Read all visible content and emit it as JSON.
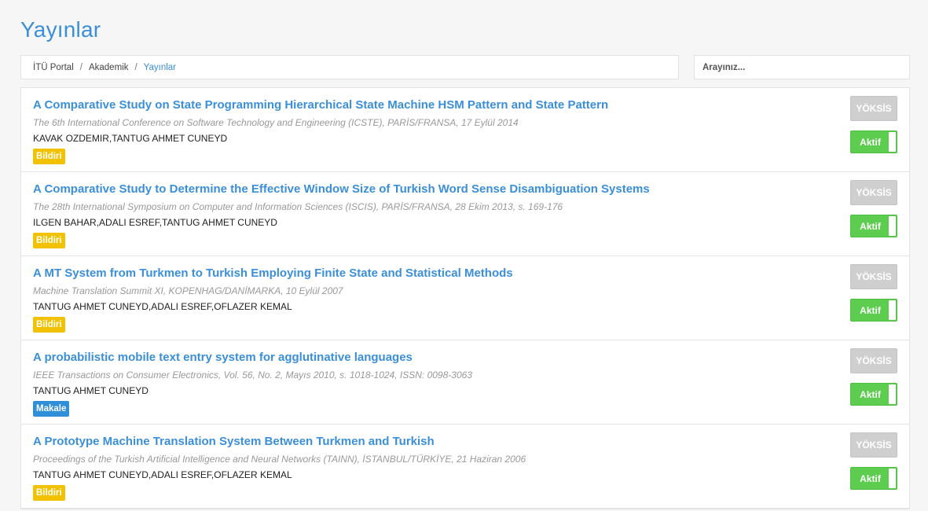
{
  "page": {
    "title": "Yayınlar"
  },
  "breadcrumb": {
    "items": [
      "İTÜ Portal",
      "Akademik",
      "Yayınlar"
    ]
  },
  "search": {
    "placeholder": "Arayınız..."
  },
  "labels": {
    "yoksis": "YÖKSİS",
    "toggle": "Aktif"
  },
  "colors": {
    "accent": "#3b8fd9",
    "bildiri": "#f2c200",
    "makale": "#2f8fd8",
    "aktif": "#5ccd4e",
    "yoksis": "#cfcfcf"
  },
  "publications": [
    {
      "title": "A Comparative Study on State Programming Hierarchical State Machine HSM Pattern and State Pattern",
      "venue": "The 6th International Conference on Software Technology and Engineering (ICSTE), PARİS/FRANSA, 17 Eylül 2014",
      "authors": "KAVAK OZDEMIR,TANTUG AHMET CUNEYD",
      "type": "Bildiri",
      "type_key": "bildiri",
      "active": true
    },
    {
      "title": "A Comparative Study to Determine the Effective Window Size of Turkish Word Sense Disambiguation Systems",
      "venue": "The 28th International Symposium on Computer and Information Sciences (ISCIS), PARİS/FRANSA, 28 Ekim 2013, s. 169-176",
      "authors": "ILGEN BAHAR,ADALI ESREF,TANTUG AHMET CUNEYD",
      "type": "Bildiri",
      "type_key": "bildiri",
      "active": true
    },
    {
      "title": "A MT System from Turkmen to Turkish Employing Finite State and Statistical Methods",
      "venue": "Machine Translation Summit XI, KOPENHAG/DANİMARKA, 10 Eylül 2007",
      "authors": "TANTUG AHMET CUNEYD,ADALI ESREF,OFLAZER KEMAL",
      "type": "Bildiri",
      "type_key": "bildiri",
      "active": true
    },
    {
      "title": "A probabilistic mobile text entry system for agglutinative languages",
      "venue": "IEEE Transactions on Consumer Electronics, Vol. 56, No. 2, Mayıs 2010, s. 1018-1024, ISSN: 0098-3063",
      "authors": "TANTUG AHMET CUNEYD",
      "type": "Makale",
      "type_key": "makale",
      "active": true
    },
    {
      "title": "A Prototype Machine Translation System Between Turkmen and Turkish",
      "venue": "Proceedings of the Turkish Artificial Intelligence and Neural Networks (TAINN), İSTANBUL/TÜRKİYE, 21 Haziran 2006",
      "authors": "TANTUG AHMET CUNEYD,ADALI ESREF,OFLAZER KEMAL",
      "type": "Bildiri",
      "type_key": "bildiri",
      "active": true
    }
  ]
}
